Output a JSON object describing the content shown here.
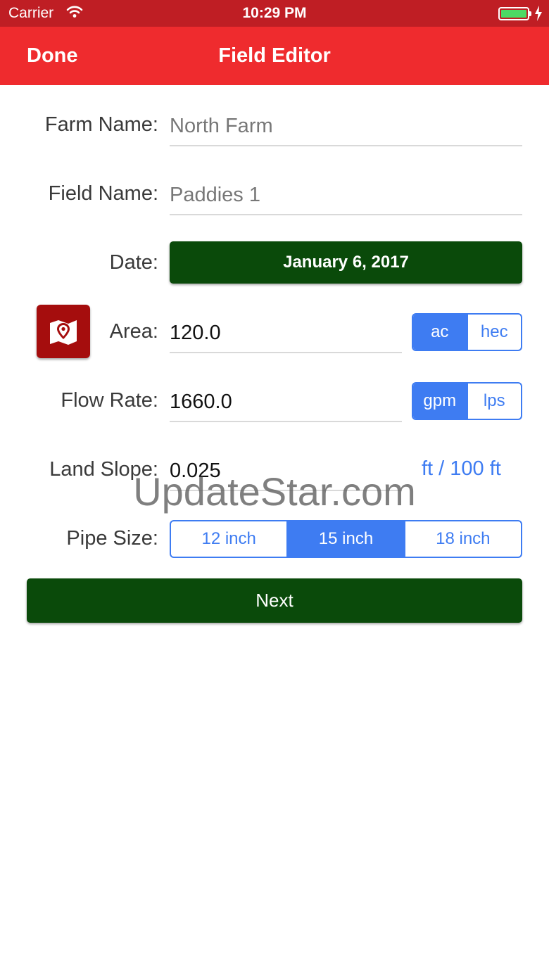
{
  "status_bar": {
    "carrier": "Carrier",
    "time": "10:29 PM",
    "battery_icon": "battery-full-charging"
  },
  "nav": {
    "done_label": "Done",
    "title": "Field Editor"
  },
  "form": {
    "farm_name": {
      "label": "Farm Name:",
      "placeholder": "North Farm"
    },
    "field_name": {
      "label": "Field Name:",
      "placeholder": "Paddies 1"
    },
    "date": {
      "label": "Date:",
      "value": "January 6, 2017"
    },
    "area": {
      "label": "Area:",
      "value": "120.0",
      "units": [
        "ac",
        "hec"
      ],
      "selected_unit": "ac",
      "map_icon": "map-pin-icon"
    },
    "flow_rate": {
      "label": "Flow Rate:",
      "value": "1660.0",
      "units": [
        "gpm",
        "lps"
      ],
      "selected_unit": "gpm"
    },
    "land_slope": {
      "label": "Land Slope:",
      "value": "0.025",
      "unit": "ft / 100 ft"
    },
    "pipe_size": {
      "label": "Pipe Size:",
      "options": [
        "12 inch",
        "15 inch",
        "18 inch"
      ],
      "selected": "15 inch"
    },
    "next_label": "Next"
  },
  "watermark": "UpdateStar.com",
  "colors": {
    "status_bar": "#bf1e24",
    "nav_bar": "#ef2b2e",
    "green_button": "#0a4a0a",
    "accent_blue": "#3e7cf2",
    "map_button": "#a50d0d"
  }
}
